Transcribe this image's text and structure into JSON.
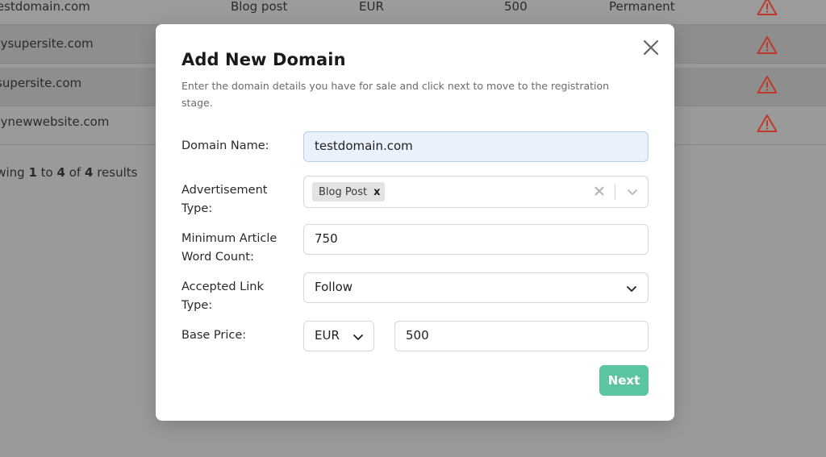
{
  "background_table": {
    "rows": [
      {
        "domain": "testdomain.com",
        "type": "Blog post",
        "currency": "EUR",
        "price": "500",
        "duration": "Permanent"
      },
      {
        "domain": "mysupersite.com"
      },
      {
        "domain": "supersite.com"
      },
      {
        "domain": "mynewwebsite.com"
      }
    ],
    "showing": {
      "prefix": "Showing",
      "from": "1",
      "to_word": "to",
      "to": "4",
      "of_word": "of",
      "total": "4",
      "suffix": "results"
    },
    "warning_icon": "warning-triangle-icon",
    "warning_color": "#c0392b"
  },
  "modal": {
    "title": "Add New Domain",
    "description": "Enter the domain details you have for sale and click next to move to the registration stage.",
    "close_icon": "close-icon",
    "fields": {
      "domain_name": {
        "label": "Domain Name:",
        "value": "testdomain.com"
      },
      "advertisement_type": {
        "label": "Advertisement Type:",
        "selected_tags": [
          "Blog Post"
        ],
        "remove_glyph": "x"
      },
      "min_word_count": {
        "label": "Minimum Article Word Count:",
        "value": "750"
      },
      "link_type": {
        "label": "Accepted Link Type:",
        "value": "Follow"
      },
      "base_price": {
        "label": "Base Price:",
        "currency": "EUR",
        "value": "500"
      }
    },
    "next_label": "Next",
    "accent_color": "#5bc4a1"
  }
}
